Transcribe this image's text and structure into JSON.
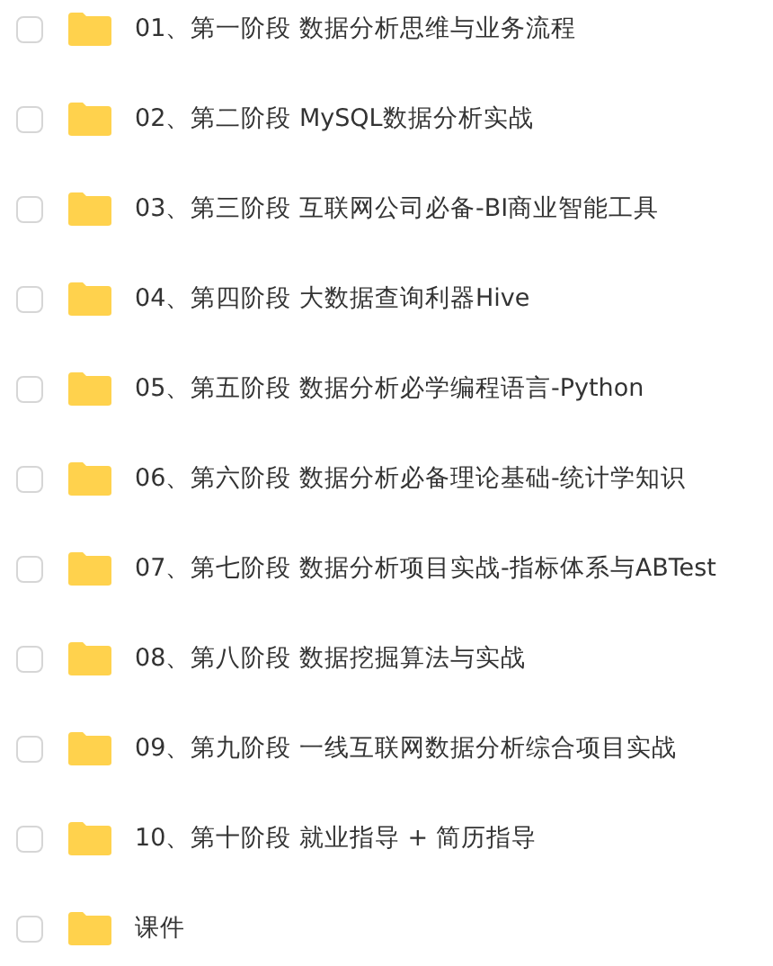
{
  "files": [
    {
      "name": "01、第一阶段 数据分析思维与业务流程",
      "checked": false
    },
    {
      "name": "02、第二阶段 MySQL数据分析实战",
      "checked": false
    },
    {
      "name": "03、第三阶段 互联网公司必备-BI商业智能工具",
      "checked": false
    },
    {
      "name": "04、第四阶段 大数据查询利器Hive",
      "checked": false
    },
    {
      "name": "05、第五阶段 数据分析必学编程语言-Python",
      "checked": false
    },
    {
      "name": "06、第六阶段 数据分析必备理论基础-统计学知识",
      "checked": false
    },
    {
      "name": "07、第七阶段 数据分析项目实战-指标体系与ABTest",
      "checked": false
    },
    {
      "name": "08、第八阶段 数据挖掘算法与实战",
      "checked": false
    },
    {
      "name": "09、第九阶段 一线互联网数据分析综合项目实战",
      "checked": false
    },
    {
      "name": "10、第十阶段 就业指导 + 简历指导",
      "checked": false
    },
    {
      "name": "课件",
      "checked": false
    }
  ]
}
